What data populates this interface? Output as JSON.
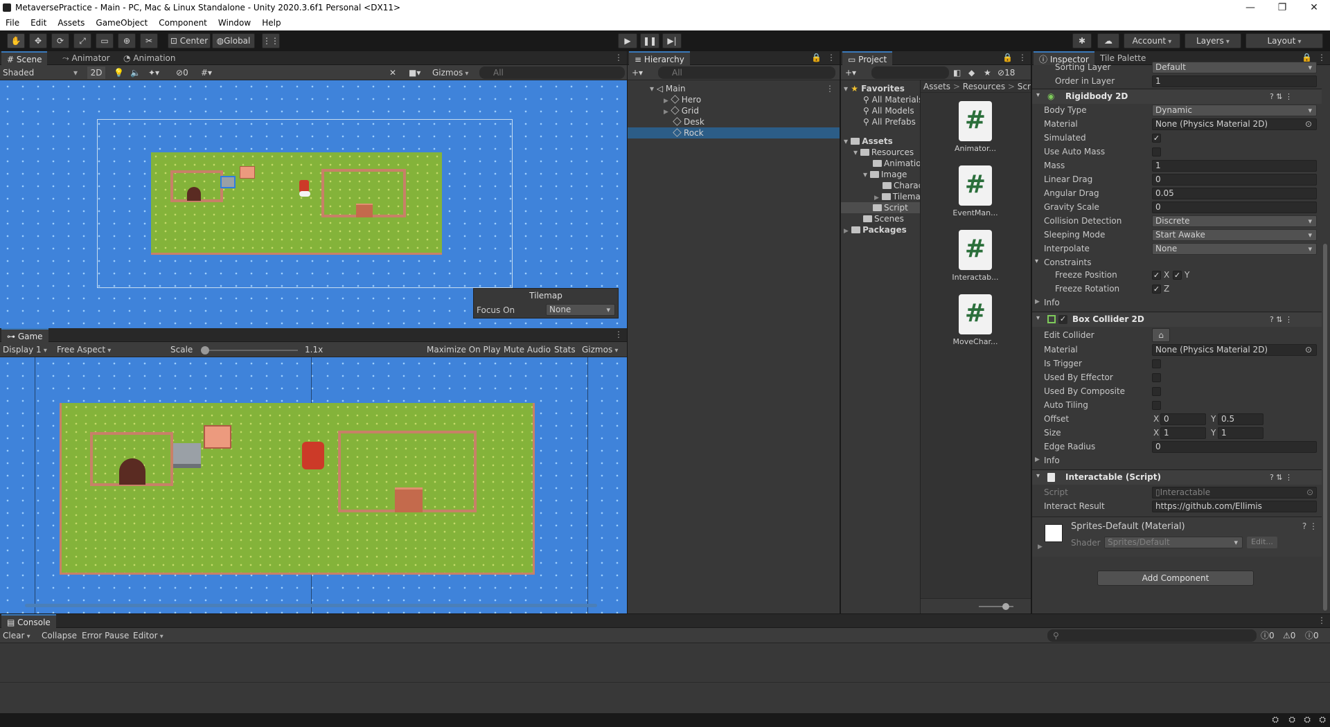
{
  "window": {
    "title": "MetaversePractice - Main - PC, Mac & Linux Standalone - Unity 2020.3.6f1 Personal <DX11>",
    "minimize": "—",
    "maximize": "❐",
    "close": "✕"
  },
  "menu": [
    "File",
    "Edit",
    "Assets",
    "GameObject",
    "Component",
    "Window",
    "Help"
  ],
  "toolbar": {
    "pivot": "Center",
    "space": "Global",
    "account": "Account",
    "layers": "Layers",
    "layout": "Layout"
  },
  "scene": {
    "tabs": [
      "Scene",
      "Animator",
      "Animation"
    ],
    "shading": "Shaded",
    "mode2d": "2D",
    "hidden_count": "0",
    "gizmos": "Gizmos",
    "search_placeholder": "All",
    "overlay": {
      "title": "Tilemap",
      "focus_label": "Focus On",
      "focus_value": "None"
    }
  },
  "game": {
    "tab": "Game",
    "display": "Display 1",
    "aspect": "Free Aspect",
    "scale_label": "Scale",
    "scale_value": "1.1x",
    "maximize": "Maximize On Play",
    "mute": "Mute Audio",
    "stats": "Stats",
    "gizmos": "Gizmos"
  },
  "hierarchy": {
    "tab": "Hierarchy",
    "search_placeholder": "All",
    "scene": "Main",
    "items": [
      "Hero",
      "Grid",
      "Desk",
      "Rock"
    ],
    "selected": "Rock"
  },
  "project": {
    "tab": "Project",
    "count": "18",
    "favorites": {
      "label": "Favorites",
      "items": [
        "All Materials",
        "All Models",
        "All Prefabs"
      ]
    },
    "assets": {
      "label": "Assets",
      "resources": "Resources",
      "animation": "Animation",
      "image": "Image",
      "charac": "Charac",
      "tilema": "Tilema",
      "script": "Script",
      "scenes": "Scenes"
    },
    "packages": "Packages",
    "breadcrumb": [
      "Assets",
      "Resources",
      "Scr"
    ],
    "files": [
      "Animator...",
      "EventMan...",
      "Interactab...",
      "MoveChar..."
    ]
  },
  "inspector": {
    "tabs": [
      "Inspector",
      "Tile Palette"
    ],
    "sorting_layer": {
      "label": "Sorting Layer",
      "value": "Default"
    },
    "order_in_layer": {
      "label": "Order in Layer",
      "value": "1"
    },
    "rigidbody": {
      "title": "Rigidbody 2D",
      "fields": [
        {
          "label": "Body Type",
          "value": "Dynamic",
          "kind": "dropdown"
        },
        {
          "label": "Material",
          "value": "None (Physics Material 2D)",
          "kind": "object"
        },
        {
          "label": "Simulated",
          "value": "✓",
          "kind": "check"
        },
        {
          "label": "Use Auto Mass",
          "value": "",
          "kind": "check"
        },
        {
          "label": "Mass",
          "value": "1",
          "kind": "field"
        },
        {
          "label": "Linear Drag",
          "value": "0",
          "kind": "field"
        },
        {
          "label": "Angular Drag",
          "value": "0.05",
          "kind": "field"
        },
        {
          "label": "Gravity Scale",
          "value": "0",
          "kind": "field"
        },
        {
          "label": "Collision Detection",
          "value": "Discrete",
          "kind": "dropdown"
        },
        {
          "label": "Sleeping Mode",
          "value": "Start Awake",
          "kind": "dropdown"
        },
        {
          "label": "Interpolate",
          "value": "None",
          "kind": "dropdown"
        }
      ],
      "constraints": "Constraints",
      "freeze_position": "Freeze Position",
      "fp_x": "X",
      "fp_y": "Y",
      "freeze_rotation": "Freeze Rotation",
      "fr_z": "Z",
      "info": "Info"
    },
    "boxcollider": {
      "title": "Box Collider 2D",
      "edit_collider": "Edit Collider",
      "fields": [
        {
          "label": "Material",
          "value": "None (Physics Material 2D)",
          "kind": "object"
        },
        {
          "label": "Is Trigger",
          "value": "",
          "kind": "check"
        },
        {
          "label": "Used By Effector",
          "value": "",
          "kind": "check"
        },
        {
          "label": "Used By Composite",
          "value": "",
          "kind": "check"
        },
        {
          "label": "Auto Tiling",
          "value": "",
          "kind": "check"
        }
      ],
      "offset": {
        "label": "Offset",
        "x": "0",
        "y": "0.5"
      },
      "size": {
        "label": "Size",
        "x": "1",
        "y": "1"
      },
      "edge_radius": {
        "label": "Edge Radius",
        "value": "0"
      },
      "axis_x": "X",
      "axis_y": "Y",
      "info": "Info"
    },
    "interactable": {
      "title": "Interactable (Script)",
      "script_label": "Script",
      "script_value": "Interactable",
      "result_label": "Interact Result",
      "result_value": "https://github.com/Ellimis"
    },
    "material": {
      "title": "Sprites-Default (Material)",
      "shader_label": "Shader",
      "shader_value": "Sprites/Default",
      "edit": "Edit..."
    },
    "add_component": "Add Component"
  },
  "console": {
    "tab": "Console",
    "clear": "Clear",
    "collapse": "Collapse",
    "error_pause": "Error Pause",
    "editor": "Editor",
    "errors": "0",
    "warnings": "0",
    "infos": "0"
  }
}
